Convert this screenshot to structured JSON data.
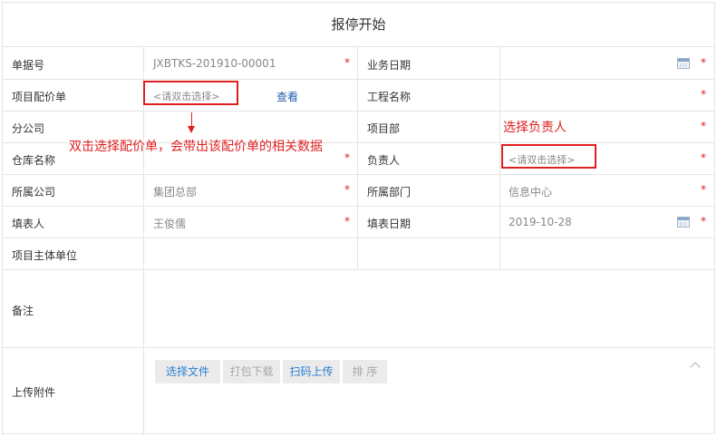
{
  "form": {
    "title": "报停开始"
  },
  "fields": {
    "doc_no": {
      "label": "单据号",
      "value": "JXBTKS-201910-00001"
    },
    "biz_date": {
      "label": "业务日期",
      "value": ""
    },
    "quote": {
      "label": "项目配价单",
      "placeholder": "<请双击选择>",
      "link": "查看"
    },
    "project_name": {
      "label": "工程名称",
      "value": ""
    },
    "branch": {
      "label": "分公司",
      "value": ""
    },
    "project_dept": {
      "label": "项目部",
      "value": ""
    },
    "warehouse": {
      "label": "仓库名称",
      "value": ""
    },
    "owner": {
      "label": "负责人",
      "placeholder": "<请双击选择>"
    },
    "company": {
      "label": "所属公司",
      "value": "集团总部"
    },
    "department": {
      "label": "所属部门",
      "value": "信息中心"
    },
    "filler": {
      "label": "填表人",
      "value": "王俊儒"
    },
    "fill_date": {
      "label": "填表日期",
      "value": "2019-10-28"
    },
    "project_entity": {
      "label": "项目主体单位",
      "value": ""
    },
    "remark": {
      "label": "备注",
      "value": ""
    },
    "attachment": {
      "label": "上传附件"
    }
  },
  "required_mark": "*",
  "annotations": {
    "quote_hint": "双击选择配价单，会带出该配价单的相关数据",
    "owner_hint": "选择负责人"
  },
  "attachment_buttons": {
    "select_file": "选择文件",
    "pack_download": "打包下载",
    "scan_upload": "扫码上传",
    "sort": "排 序"
  },
  "colors": {
    "required": "#e02020",
    "annotation": "#e02020",
    "link": "#1f5fae",
    "button_active": "#2a7fd3",
    "button_disabled": "#a8a8a8"
  },
  "icons": {
    "calendar": "calendar-icon",
    "collapse": "chevron-up-icon",
    "arrow": "arrow-down-icon"
  }
}
